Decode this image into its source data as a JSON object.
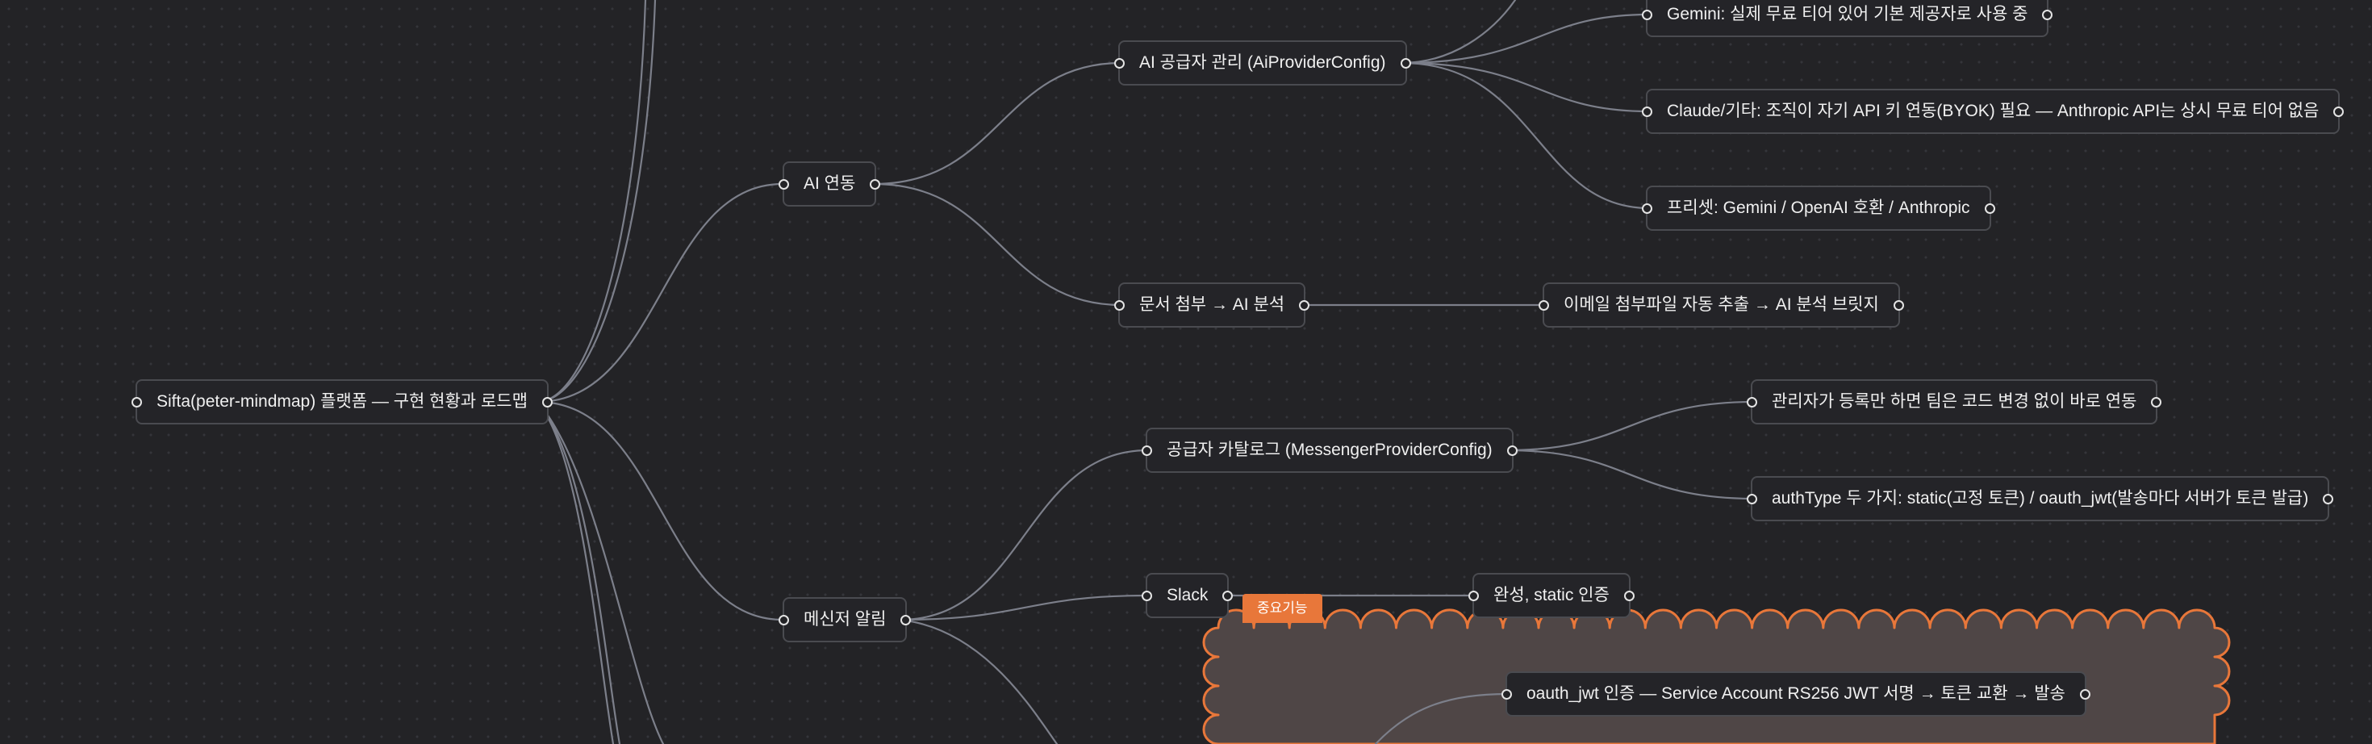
{
  "mindmap": {
    "root": "Sifta(peter-mindmap) 플랫폼 — 구현 현황과 로드맵",
    "branches": {
      "ai": "AI 연동",
      "ai_provider": "AI 공급자 관리 (AiProviderConfig)",
      "gemini": "Gemini: 실제 무료 티어 있어 기본 제공자로 사용 중",
      "claude": "Claude/기타: 조직이 자기 API 키 연동(BYOK) 필요 — Anthropic API는 상시 무료 티어 없음",
      "preset": "프리셋: Gemini / OpenAI 호환 / Anthropic",
      "doc_attach": "문서 첨부 → AI 분석",
      "email_bridge": "이메일 첨부파일 자동 추출 → AI 분석 브릿지",
      "messenger": "메신저 알림",
      "provider_catalog": "공급자 카탈로그 (MessengerProviderConfig)",
      "admin_register": "관리자가 등록만 하면 팀은 코드 변경 없이 바로 연동",
      "auth_type": "authType 두 가지: static(고정 토큰) / oauth_jwt(발송마다 서버가 토큰 발급)",
      "slack": "Slack",
      "slack_done": "완성, static 인증",
      "oauth_jwt": "oauth_jwt 인증 — Service Account RS256 JWT 서명 → 토큰 교환 → 발송"
    },
    "highlight_badge": "중요기능",
    "colors": {
      "background": "#232326",
      "node_border": "#4a4b50",
      "edge": "#7c7f8a",
      "highlight": "#e8773a",
      "highlight_fill": "#4f4646"
    }
  }
}
